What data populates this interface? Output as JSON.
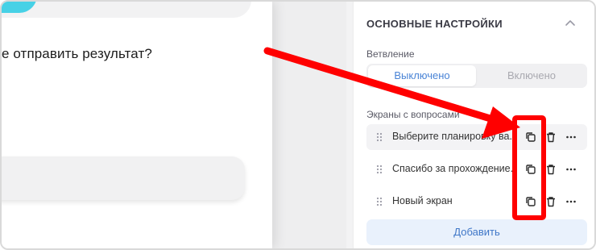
{
  "canvas": {
    "question_text": "е отправить результат?"
  },
  "panel": {
    "section_title": "ОСНОВНЫЕ НАСТРОЙКИ",
    "branching": {
      "label": "Ветвление",
      "options": [
        "Выключено",
        "Включено"
      ],
      "selected": "Выключено"
    },
    "screens": {
      "label": "Экраны с вопросами",
      "items": [
        {
          "label": "Выберите планировку ва..."
        },
        {
          "label": "Спасибо за прохождение..."
        },
        {
          "label": "Новый экран"
        }
      ]
    },
    "add_label": "Добавить"
  },
  "colors": {
    "accent": "#4a84d6",
    "annotation": "#ff0000",
    "teal_accent": "#47d1e6"
  },
  "icons": [
    "chevron-up-icon",
    "drag-handle-icon",
    "copy-icon",
    "trash-icon",
    "more-icon"
  ]
}
